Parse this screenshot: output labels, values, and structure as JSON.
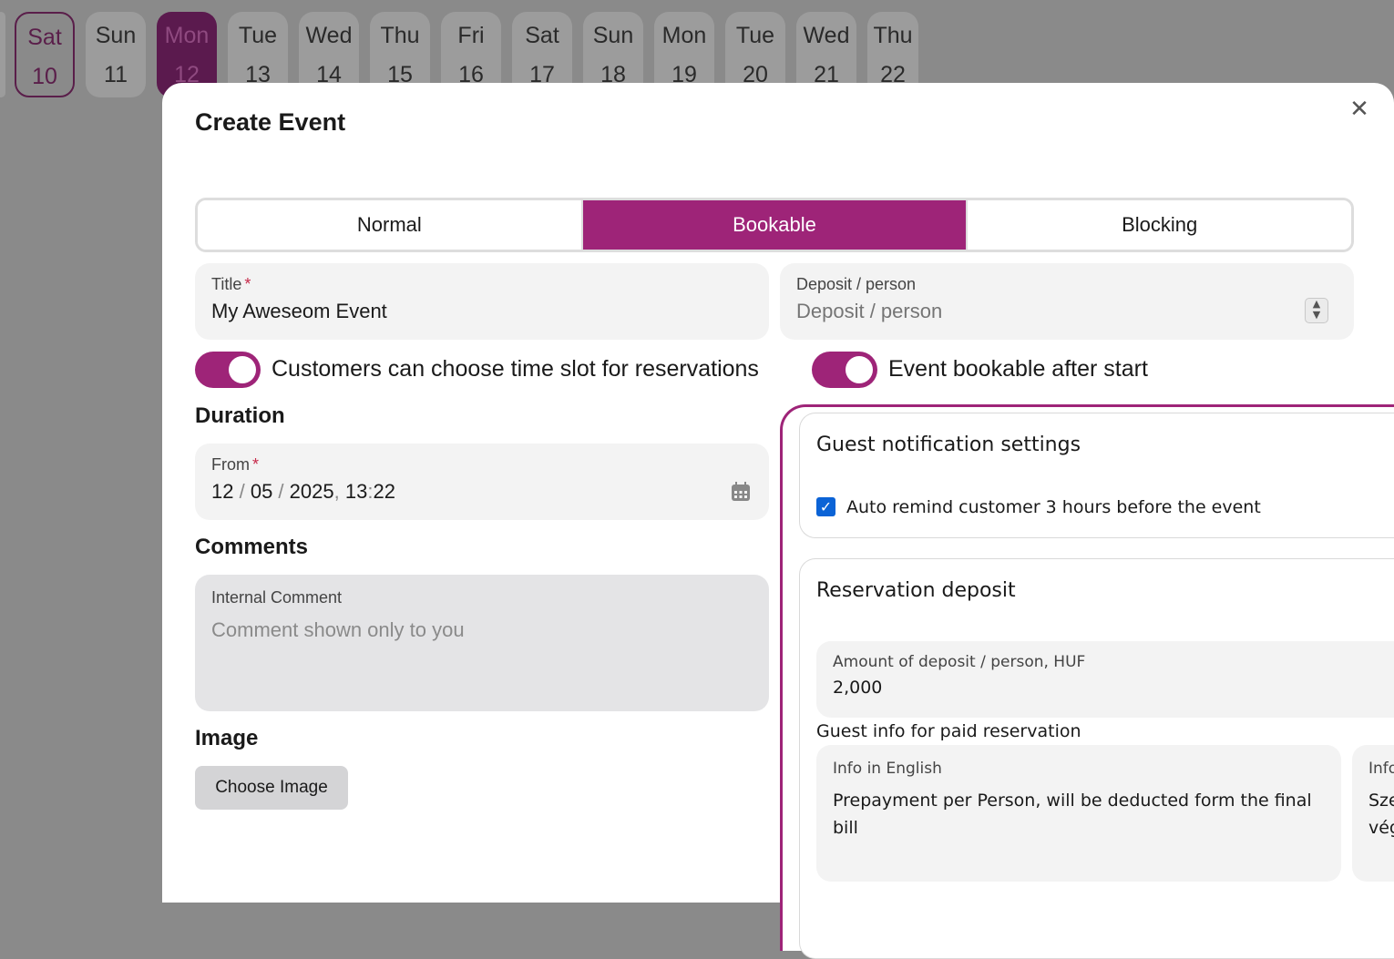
{
  "calendar": {
    "days": [
      {
        "name": "Sat",
        "date": "10"
      },
      {
        "name": "Sun",
        "date": "11"
      },
      {
        "name": "Mon",
        "date": "12"
      },
      {
        "name": "Tue",
        "date": "13"
      },
      {
        "name": "Wed",
        "date": "14"
      },
      {
        "name": "Thu",
        "date": "15"
      },
      {
        "name": "Fri",
        "date": "16"
      },
      {
        "name": "Sat",
        "date": "17"
      },
      {
        "name": "Sun",
        "date": "18"
      },
      {
        "name": "Mon",
        "date": "19"
      },
      {
        "name": "Tue",
        "date": "20"
      },
      {
        "name": "Wed",
        "date": "21"
      },
      {
        "name": "Thu",
        "date": "22"
      }
    ]
  },
  "modal": {
    "title": "Create Event",
    "close_glyph": "✕",
    "event_types": [
      "Normal",
      "Bookable",
      "Blocking"
    ],
    "active_type": "Bookable"
  },
  "form": {
    "title_label": "Title",
    "title_value": "My Aweseom Event",
    "required_mark": "*",
    "deposit_label": "Deposit / person",
    "deposit_placeholder": "Deposit / person",
    "toggle_timeslot_label": "Customers can choose time slot for reservations",
    "toggle_after_start_label": "Event bookable after start",
    "duration_heading": "Duration",
    "from_label": "From",
    "from_day": "12",
    "from_month": "05",
    "from_year": "2025",
    "from_hour": "13",
    "from_minute": "22",
    "comments_heading": "Comments",
    "internal_comment_label": "Internal Comment",
    "internal_comment_placeholder": "Comment shown only to you",
    "image_heading": "Image",
    "choose_image_label": "Choose Image"
  },
  "settings": {
    "notification_title": "Guest notification settings",
    "auto_remind_label": "Auto remind customer 3 hours before the event",
    "auto_remind_checked": true,
    "deposit_title": "Reservation deposit",
    "amount_label": "Amount of deposit / person, HUF",
    "amount_value": "2,000",
    "guest_info_label": "Guest info for paid reservation",
    "info_en_label": "Info in English",
    "info_en_value": "Prepayment per Person, will be deducted form the final bill",
    "info_hu_label_partial": "Info",
    "info_hu_value_partial_1": "Sze",
    "info_hu_value_partial_2": "vég"
  },
  "colors": {
    "accent": "#9e2478",
    "checkbox": "#0b63d6"
  }
}
